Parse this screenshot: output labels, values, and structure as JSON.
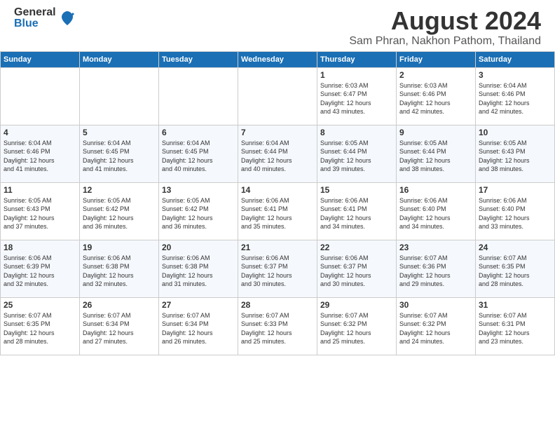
{
  "header": {
    "logo_general": "General",
    "logo_blue": "Blue",
    "main_title": "August 2024",
    "subtitle": "Sam Phran, Nakhon Pathom, Thailand"
  },
  "calendar": {
    "headers": [
      "Sunday",
      "Monday",
      "Tuesday",
      "Wednesday",
      "Thursday",
      "Friday",
      "Saturday"
    ],
    "weeks": [
      [
        {
          "day": "",
          "info": ""
        },
        {
          "day": "",
          "info": ""
        },
        {
          "day": "",
          "info": ""
        },
        {
          "day": "",
          "info": ""
        },
        {
          "day": "1",
          "info": "Sunrise: 6:03 AM\nSunset: 6:47 PM\nDaylight: 12 hours\nand 43 minutes."
        },
        {
          "day": "2",
          "info": "Sunrise: 6:03 AM\nSunset: 6:46 PM\nDaylight: 12 hours\nand 42 minutes."
        },
        {
          "day": "3",
          "info": "Sunrise: 6:04 AM\nSunset: 6:46 PM\nDaylight: 12 hours\nand 42 minutes."
        }
      ],
      [
        {
          "day": "4",
          "info": "Sunrise: 6:04 AM\nSunset: 6:46 PM\nDaylight: 12 hours\nand 41 minutes."
        },
        {
          "day": "5",
          "info": "Sunrise: 6:04 AM\nSunset: 6:45 PM\nDaylight: 12 hours\nand 41 minutes."
        },
        {
          "day": "6",
          "info": "Sunrise: 6:04 AM\nSunset: 6:45 PM\nDaylight: 12 hours\nand 40 minutes."
        },
        {
          "day": "7",
          "info": "Sunrise: 6:04 AM\nSunset: 6:44 PM\nDaylight: 12 hours\nand 40 minutes."
        },
        {
          "day": "8",
          "info": "Sunrise: 6:05 AM\nSunset: 6:44 PM\nDaylight: 12 hours\nand 39 minutes."
        },
        {
          "day": "9",
          "info": "Sunrise: 6:05 AM\nSunset: 6:44 PM\nDaylight: 12 hours\nand 38 minutes."
        },
        {
          "day": "10",
          "info": "Sunrise: 6:05 AM\nSunset: 6:43 PM\nDaylight: 12 hours\nand 38 minutes."
        }
      ],
      [
        {
          "day": "11",
          "info": "Sunrise: 6:05 AM\nSunset: 6:43 PM\nDaylight: 12 hours\nand 37 minutes."
        },
        {
          "day": "12",
          "info": "Sunrise: 6:05 AM\nSunset: 6:42 PM\nDaylight: 12 hours\nand 36 minutes."
        },
        {
          "day": "13",
          "info": "Sunrise: 6:05 AM\nSunset: 6:42 PM\nDaylight: 12 hours\nand 36 minutes."
        },
        {
          "day": "14",
          "info": "Sunrise: 6:06 AM\nSunset: 6:41 PM\nDaylight: 12 hours\nand 35 minutes."
        },
        {
          "day": "15",
          "info": "Sunrise: 6:06 AM\nSunset: 6:41 PM\nDaylight: 12 hours\nand 34 minutes."
        },
        {
          "day": "16",
          "info": "Sunrise: 6:06 AM\nSunset: 6:40 PM\nDaylight: 12 hours\nand 34 minutes."
        },
        {
          "day": "17",
          "info": "Sunrise: 6:06 AM\nSunset: 6:40 PM\nDaylight: 12 hours\nand 33 minutes."
        }
      ],
      [
        {
          "day": "18",
          "info": "Sunrise: 6:06 AM\nSunset: 6:39 PM\nDaylight: 12 hours\nand 32 minutes."
        },
        {
          "day": "19",
          "info": "Sunrise: 6:06 AM\nSunset: 6:38 PM\nDaylight: 12 hours\nand 32 minutes."
        },
        {
          "day": "20",
          "info": "Sunrise: 6:06 AM\nSunset: 6:38 PM\nDaylight: 12 hours\nand 31 minutes."
        },
        {
          "day": "21",
          "info": "Sunrise: 6:06 AM\nSunset: 6:37 PM\nDaylight: 12 hours\nand 30 minutes."
        },
        {
          "day": "22",
          "info": "Sunrise: 6:06 AM\nSunset: 6:37 PM\nDaylight: 12 hours\nand 30 minutes."
        },
        {
          "day": "23",
          "info": "Sunrise: 6:07 AM\nSunset: 6:36 PM\nDaylight: 12 hours\nand 29 minutes."
        },
        {
          "day": "24",
          "info": "Sunrise: 6:07 AM\nSunset: 6:35 PM\nDaylight: 12 hours\nand 28 minutes."
        }
      ],
      [
        {
          "day": "25",
          "info": "Sunrise: 6:07 AM\nSunset: 6:35 PM\nDaylight: 12 hours\nand 28 minutes."
        },
        {
          "day": "26",
          "info": "Sunrise: 6:07 AM\nSunset: 6:34 PM\nDaylight: 12 hours\nand 27 minutes."
        },
        {
          "day": "27",
          "info": "Sunrise: 6:07 AM\nSunset: 6:34 PM\nDaylight: 12 hours\nand 26 minutes."
        },
        {
          "day": "28",
          "info": "Sunrise: 6:07 AM\nSunset: 6:33 PM\nDaylight: 12 hours\nand 25 minutes."
        },
        {
          "day": "29",
          "info": "Sunrise: 6:07 AM\nSunset: 6:32 PM\nDaylight: 12 hours\nand 25 minutes."
        },
        {
          "day": "30",
          "info": "Sunrise: 6:07 AM\nSunset: 6:32 PM\nDaylight: 12 hours\nand 24 minutes."
        },
        {
          "day": "31",
          "info": "Sunrise: 6:07 AM\nSunset: 6:31 PM\nDaylight: 12 hours\nand 23 minutes."
        }
      ]
    ]
  }
}
